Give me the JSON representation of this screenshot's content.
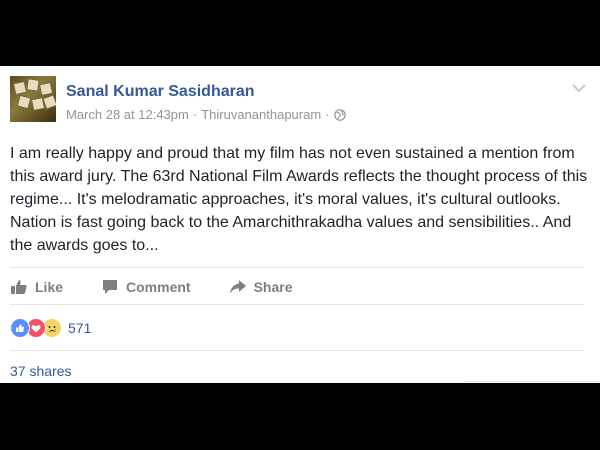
{
  "post": {
    "author": "Sanal Kumar Sasidharan",
    "timestamp": "March 28 at 12:43pm",
    "separator": "·",
    "location": "Thiruvananthapuram",
    "separator2": "·",
    "privacy_icon": "globe-icon",
    "menu_icon": "chevron-down-icon",
    "text": "I am really happy and proud that my film has not even sustained a mention from this award jury. The 63rd National Film Awards reflects the thought process of this regime... It's melodramatic approaches, it's moral values, it's cultural outlooks. Nation is fast going back to the Amarchithrakadha values and sensibilities.. And the awards goes to..."
  },
  "actions": {
    "like_label": "Like",
    "comment_label": "Comment",
    "share_label": "Share"
  },
  "reactions": {
    "icons": [
      "like-reaction-icon",
      "love-reaction-icon",
      "sad-reaction-icon"
    ],
    "count": "571"
  },
  "shares": {
    "label": "37 shares"
  },
  "colors": {
    "link": "#365899",
    "meta": "#90949c",
    "action": "#7f7f7f",
    "like": "#5890ff",
    "love": "#f25268",
    "sad": "#f7d264",
    "background": "#000000"
  }
}
